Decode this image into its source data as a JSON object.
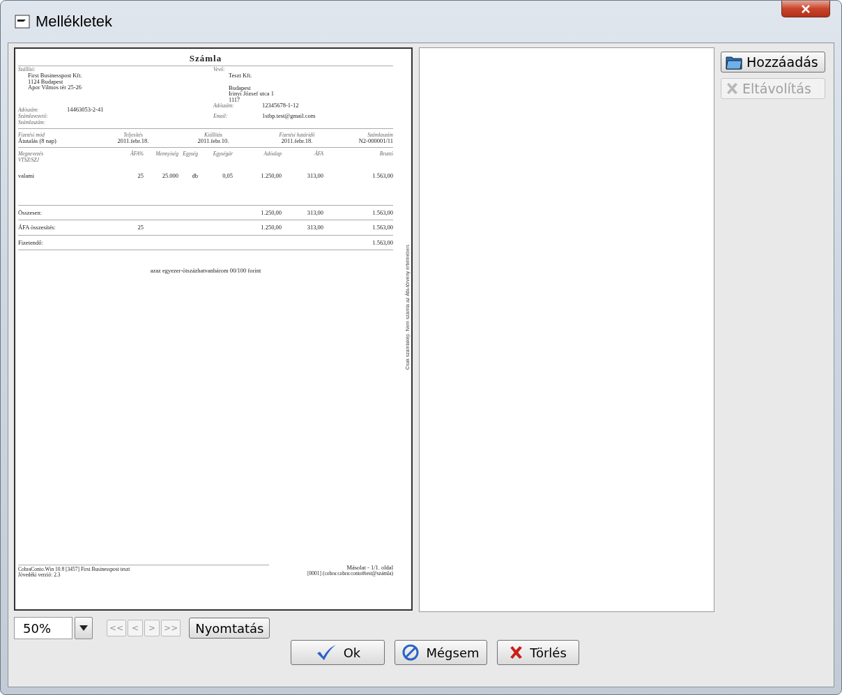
{
  "window": {
    "title": "Mellékletek"
  },
  "document": {
    "title": "Számla",
    "seller": {
      "label": "Szállító:",
      "lines": [
        "First Businesspost Kft.",
        "1124 Budapest",
        "Apor Vilmos tér 25-26"
      ]
    },
    "buyer": {
      "label": "Vevő:",
      "lines": [
        "Teszt Kft.",
        "Budapest",
        "Irinyi József utca 1",
        "1117"
      ]
    },
    "seller_fields": [
      {
        "label": "Adószám:",
        "value": "14463053-2-41"
      },
      {
        "label": "Számlavezető:"
      },
      {
        "label": "Számlaszám:"
      }
    ],
    "buyer_fields": [
      {
        "label": "Adószám:",
        "value": "12345678-1-12"
      },
      {
        "label": "Email:",
        "value": "1stbp.test@gmail.com"
      }
    ],
    "payment": [
      {
        "label": "Fizetési mód",
        "value": "Átutalás (8 nap)"
      },
      {
        "label": "Teljesítés",
        "value": "2011.febr.18."
      },
      {
        "label": "Kiállítás",
        "value": "2011.febr.10."
      },
      {
        "label": "Fizetési határidő",
        "value": "2011.febr.18."
      },
      {
        "label": "Számlaszám",
        "value": "N2-000001/11"
      }
    ],
    "item_columns": [
      {
        "label": "Megnevezés",
        "sublabel": "VTSZ/SZJ"
      },
      {
        "label": "ÁFA%"
      },
      {
        "label": "Mennyiség"
      },
      {
        "label": "Egység"
      },
      {
        "label": "Egységár"
      },
      {
        "label": "Adóalap"
      },
      {
        "label": "ÁFA"
      },
      {
        "label": "Bruttó"
      }
    ],
    "items": [
      {
        "name": "valami",
        "vat_rate": "25",
        "quantity": "25.000",
        "unit": "db",
        "unit_price": "0,05",
        "net": "1.250,00",
        "vat": "313,00",
        "gross": "1.563,00"
      }
    ],
    "summary_rows": [
      {
        "name": "Összesen:",
        "net": "1.250,00",
        "vat": "313,00",
        "gross": "1.563,00"
      },
      {
        "name": "ÁFA összesítés:",
        "vat_rate": "25",
        "net": "1.250,00",
        "vat": "313,00",
        "gross": "1.563,00"
      }
    ],
    "payable": {
      "label": "Fizetendő:",
      "value": "1.563,00"
    },
    "amount_in_words": "azaz egyezer-ötszázhatvanhárom 00/100 forint",
    "side_note": "Csak számlakép. Nem számla az Áfa-törvény értelmében.",
    "footer_left": [
      "CobraConto.Win 10.8 [3457] First Businesspost teszt",
      "Jövedéki verzió: 2.3"
    ],
    "footer_right": [
      "Másolat - 1/1. oldal",
      "[0001] (cobra:cobra:conto#test@számla)"
    ]
  },
  "side_buttons": [
    {
      "kind": "add",
      "label": "Hozzáadás",
      "disabled": false
    },
    {
      "kind": "remove",
      "label": "Eltávolítás",
      "disabled": true
    }
  ],
  "zoom": {
    "value": "50%"
  },
  "nav_buttons": [
    {
      "label": "<<",
      "disabled": true
    },
    {
      "label": "<",
      "disabled": true
    },
    {
      "label": ">",
      "disabled": true
    },
    {
      "label": ">>",
      "disabled": true
    }
  ],
  "print_button": {
    "label": "Nyomtatás"
  },
  "dialog_buttons": [
    {
      "kind": "ok",
      "label": "Ok"
    },
    {
      "kind": "cancel",
      "label": "Mégsem"
    },
    {
      "kind": "delete",
      "label": "Törlés"
    }
  ]
}
